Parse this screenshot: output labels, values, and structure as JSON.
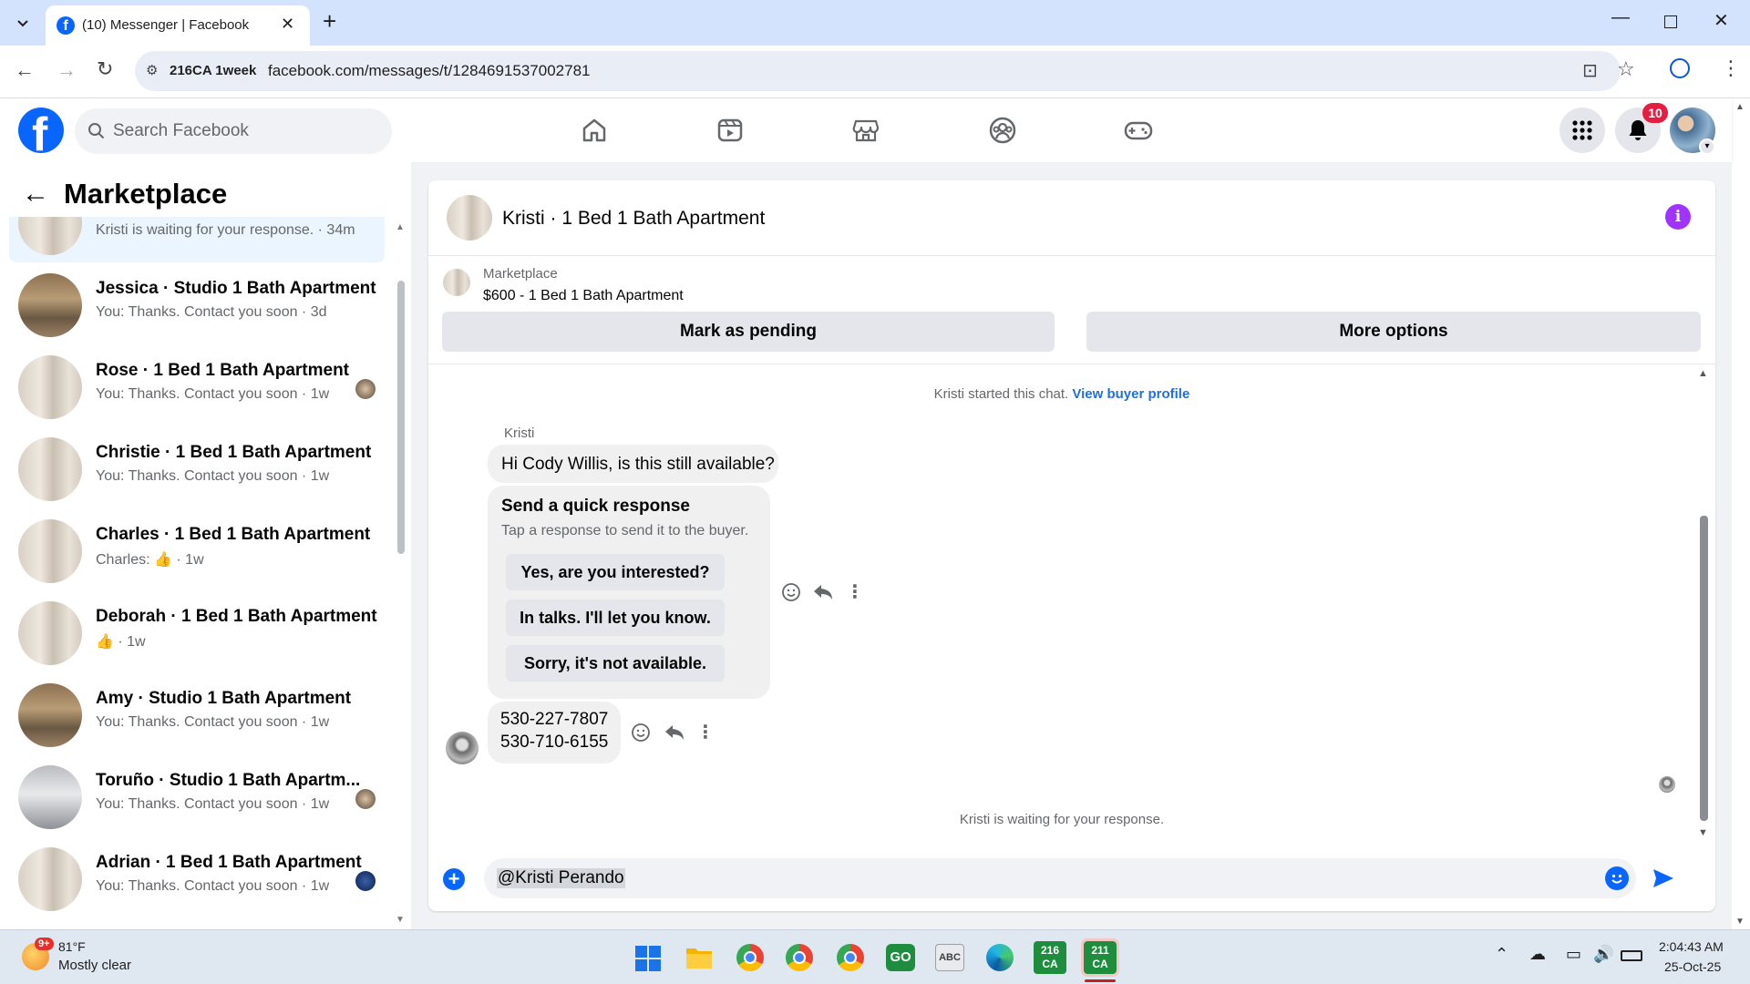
{
  "browser": {
    "tab_title": "(10) Messenger | Facebook",
    "site_info": "216CA 1week",
    "url": "facebook.com/messages/t/1284691537002781"
  },
  "fb_header": {
    "search_placeholder": "Search Facebook",
    "notification_count": "10"
  },
  "sidebar": {
    "title": "Marketplace",
    "conversations": [
      {
        "title": "Kristi · 1 Bed 1 Bath Apartment",
        "snippet": "Kristi is waiting for your response. · 34m",
        "avatar": "wall",
        "selected": true
      },
      {
        "title": "Jessica · Studio 1 Bath Apartment",
        "snippet": "You: Thanks. Contact you soon · 3d",
        "avatar": "room"
      },
      {
        "title": "Rose · 1 Bed 1 Bath Apartment",
        "snippet": "You: Thanks. Contact you soon · 1w",
        "avatar": "wall",
        "seen": true
      },
      {
        "title": "Christie · 1 Bed 1 Bath Apartment",
        "snippet": "You: Thanks. Contact you soon · 1w",
        "avatar": "wall"
      },
      {
        "title": "Charles · 1 Bed 1 Bath Apartment",
        "snippet": "Charles: 👍 · 1w",
        "avatar": "wall"
      },
      {
        "title": "Deborah · 1 Bed 1 Bath Apartment",
        "snippet": "👍 · 1w",
        "avatar": "wall"
      },
      {
        "title": "Amy · Studio 1 Bath Apartment",
        "snippet": "You: Thanks. Contact you soon · 1w",
        "avatar": "room"
      },
      {
        "title": "Toruño · Studio 1 Bath Apartm...",
        "snippet": "You: Thanks. Contact you soon · 1w",
        "avatar": "grey",
        "seen": true
      },
      {
        "title": "Adrian · 1 Bed 1 Bath Apartment",
        "snippet": "You: Thanks. Contact you soon · 1w",
        "avatar": "wall",
        "seen": true
      }
    ]
  },
  "chat": {
    "title": "Kristi · 1 Bed 1 Bath Apartment",
    "listing_source": "Marketplace",
    "listing_name": "$600 - 1 Bed 1 Bath Apartment",
    "mark_pending_label": "Mark as pending",
    "more_options_label": "More options",
    "started_text": "Kristi started this chat.",
    "buyer_profile_link": "View buyer profile",
    "sender_name": "Kristi",
    "first_message": "Hi Cody Willis, is this still available?",
    "quick_response_title": "Send a quick response",
    "quick_response_subtitle": "Tap a response to send it to the buyer.",
    "quick_responses": [
      "Yes, are you interested?",
      "In talks. I'll let you know.",
      "Sorry, it's not available."
    ],
    "phone_1": "530-227-7807",
    "phone_2": "530-710-6155",
    "waiting_text": "Kristi is waiting for your response.",
    "composer_value": "@Kristi Perando"
  },
  "taskbar": {
    "weather_temp": "81°F",
    "weather_desc": "Mostly clear",
    "weather_badge": "9+",
    "time": "2:04:43 AM",
    "date": "25-Oct-25",
    "app_216_label": "216\nCA",
    "app_211_label": "211\nCA"
  },
  "colors": {
    "fb_blue": "#0866ff",
    "link_blue": "#216fdb",
    "info_purple": "#a033ff",
    "badge_red": "#e41e3f"
  }
}
